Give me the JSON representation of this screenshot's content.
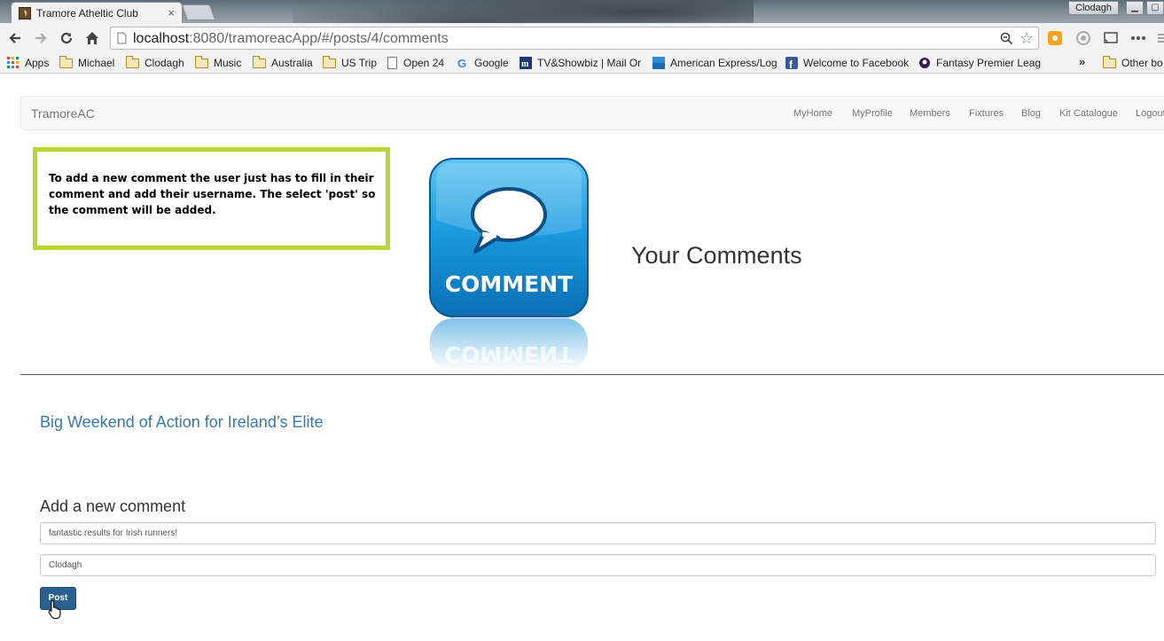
{
  "browser": {
    "tab_title": "Tramore Atheltic Club",
    "tab_close": "×",
    "user": "Clodagh",
    "url_host": "localhost",
    "url_path": ":8080/tramoreacApp/#/posts/4/comments",
    "bookmarks": [
      {
        "label": "Apps",
        "icon": "apps-grid-icon"
      },
      {
        "label": "Michael",
        "icon": "folder-icon"
      },
      {
        "label": "Clodagh",
        "icon": "folder-icon"
      },
      {
        "label": "Music",
        "icon": "folder-icon"
      },
      {
        "label": "Australia",
        "icon": "folder-icon"
      },
      {
        "label": "US Trip",
        "icon": "folder-icon"
      },
      {
        "label": "Open 24",
        "icon": "page-icon"
      },
      {
        "label": "Google",
        "icon": "google-icon"
      },
      {
        "label": "TV&Showbiz | Mail Or",
        "icon": "dailymail-icon"
      },
      {
        "label": "American Express/Log",
        "icon": "amex-icon"
      },
      {
        "label": "Welcome to Facebook",
        "icon": "facebook-icon"
      },
      {
        "label": "Fantasy Premier Leag",
        "icon": "premier-league-icon"
      }
    ],
    "bookmarks_overflow": "»",
    "other_bookmarks": "Other bo"
  },
  "navbar": {
    "brand": "TramoreAC",
    "items": [
      "MyHome",
      "MyProfile",
      "Members",
      "Fixtures",
      "Blog",
      "Kit Catalogue",
      "Logout"
    ]
  },
  "callout": {
    "text": "To add a new comment the user just has to fill in their comment and add their username. The select 'post' so the comment will be added."
  },
  "hero": {
    "logo_text": "COMMENT",
    "title": "Your Comments"
  },
  "post": {
    "title": "Big Weekend of Action for Ireland’s Elite"
  },
  "comment_form": {
    "heading": "Add a new comment",
    "comment_value": "fantastic results for Irish runners!",
    "username_value": "Clodagh",
    "submit_label": "Post"
  },
  "colors": {
    "callout_border": "#bbd536",
    "link": "#337ab7",
    "button": "#28608f",
    "logo_blue": "#1a8fd6"
  }
}
